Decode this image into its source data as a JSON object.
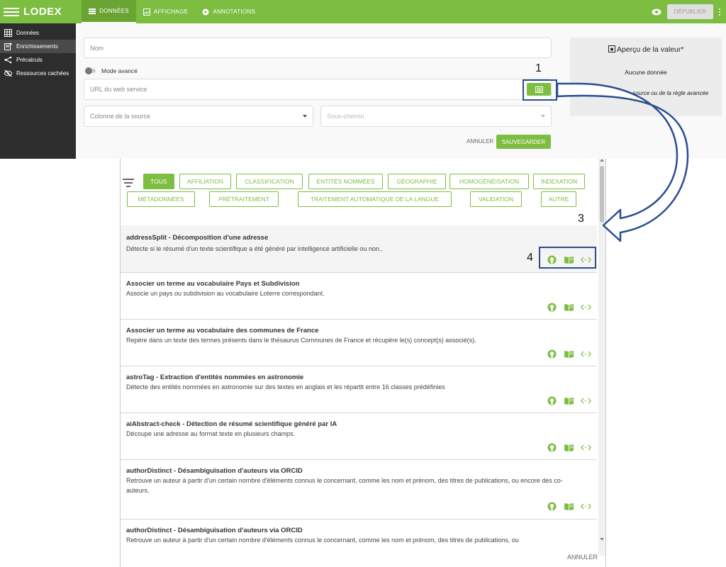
{
  "app": {
    "logo": "LODEX",
    "tabs": [
      {
        "label": "DONNÉES",
        "icon": "list-icon"
      },
      {
        "label": "AFFICHAGE",
        "icon": "image-icon"
      },
      {
        "label": "ANNOTATIONS",
        "icon": "comment-icon"
      }
    ],
    "publish_label": "DÉPUBLIER"
  },
  "sidebar": {
    "items": [
      {
        "label": "Données",
        "icon": "table-icon"
      },
      {
        "label": "Enrichissements",
        "icon": "enrich-icon"
      },
      {
        "label": "Précalculs",
        "icon": "flow-icon"
      },
      {
        "label": "Ressources cachées",
        "icon": "eye-off-icon"
      }
    ]
  },
  "form": {
    "name_placeholder": "Nom",
    "advanced_mode_label": "Mode avancé",
    "url_placeholder": "URL du web service",
    "source_column_placeholder": "Colonne de la source",
    "subpath_placeholder": "Sous-chemin",
    "cancel_label": "ANNULER",
    "save_label": "SAUVEGARDER"
  },
  "preview": {
    "title": "Aperçu de la valeur*",
    "empty": "Aucune donnée",
    "note": "* valeur de la colonne source ou de la règle avancée"
  },
  "annotations": {
    "n1": "1",
    "n3": "3",
    "n4": "4"
  },
  "dialog": {
    "filters": [
      "TOUS",
      "AFFILIATION",
      "CLASSIFICATION",
      "ENTITÉS NOMMÉES",
      "GÉOGRAPHIE",
      "HOMOGÉNÉISATION",
      "INDEXATION",
      "MÉTADONNÉES",
      "PRÉTRAITEMENT",
      "TRAITEMENT AUTOMATIQUE DE LA LANGUE",
      "VALIDATION",
      "AUTRE"
    ],
    "active_filter": "TOUS",
    "services": [
      {
        "title": "addressSplit - Décomposition d'une adresse",
        "description": "Détecte si le résumé d'un texte scientifique a été généré par intelligence artificielle ou non.."
      },
      {
        "title": "Associer un terme au vocabulaire Pays et Subdivision",
        "description": "Associe un pays ou subdivision au vocabulaire Loterre correspondant."
      },
      {
        "title": "Associer un terme au vocabulaire des communes de France",
        "description": "Repère dans un texte des termes présents dans le thésaurus Communes de France et récupère le(s) concept(s) associé(s)."
      },
      {
        "title": "astroTag - Extraction d'entités nommées en astronomie",
        "description": "Détecte des entités nommées en astronomie sur des textes en anglais et les répartit entre 16 classes prédéfinies"
      },
      {
        "title": "aiAbstract-check - Détection de résumé scientifique généré par IA",
        "description": "Découpe une adresse au format texte en plusieurs champs."
      },
      {
        "title": "authorDistinct - Désambiguïsation d'auteurs via ORCID",
        "description": "Retrouve un auteur à partir d'un certain nombre d'éléments connus le concernant, comme les nom et prénom, des titres de publications, ou encore des co-auteurs."
      },
      {
        "title": "authorDistinct - Désambiguïsation d'auteurs via ORCID",
        "description": "Retrouve un auteur à partir d'un certain nombre d'éléments connus le concernant, comme les nom et prénom, des titres de publications, ou"
      }
    ],
    "cancel_label": "ANNULER"
  },
  "colors": {
    "accent": "#7dbd42",
    "sidebar": "#2d2d2d",
    "annotation": "#2a4e8f"
  }
}
